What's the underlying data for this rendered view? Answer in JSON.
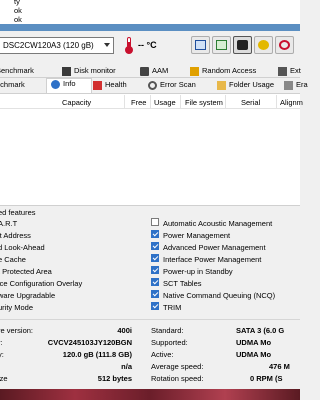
{
  "top_lines": [
    "ty",
    "ok",
    "ok"
  ],
  "toolbar": {
    "disk_select": "DSC2CW120A3 (120 gB)",
    "temperature": "-- °C",
    "colors": {
      "accent": "#2e71c7",
      "heart": "#d23030",
      "thermo": "#c8102e"
    }
  },
  "tabs_row1": [
    {
      "label": "Benchmark",
      "icon": "benchmark-icon"
    },
    {
      "label": "Disk monitor",
      "icon": "disk-monitor-icon"
    },
    {
      "label": "AAM",
      "icon": "speaker-icon"
    },
    {
      "label": "Random Access",
      "icon": "random-access-icon"
    },
    {
      "label": "Ext",
      "icon": "extra-icon"
    }
  ],
  "tabs_row2": [
    {
      "label": "nchmark",
      "icon": ""
    },
    {
      "label": "Info",
      "icon": "info-icon"
    },
    {
      "label": "Health",
      "icon": "health-icon"
    },
    {
      "label": "Error Scan",
      "icon": "error-scan-icon"
    },
    {
      "label": "Folder Usage",
      "icon": "folder-icon"
    },
    {
      "label": "Era",
      "icon": "erase-icon"
    }
  ],
  "partition_table": {
    "columns": [
      "Capacity",
      "Free",
      "Usage",
      "File system",
      "Serial",
      "Alignm"
    ]
  },
  "features": {
    "title": "ed features",
    "left": [
      "A.R.T",
      "it Address",
      "d Look-Ahead",
      "e Cache",
      "t Protected Area",
      "ice Configuration Overlay",
      "ware Upgradable",
      "urity Mode"
    ],
    "right": [
      {
        "label": "Automatic Acoustic Management",
        "checked": false
      },
      {
        "label": "Power Management",
        "checked": true
      },
      {
        "label": "Advanced Power Management",
        "checked": true
      },
      {
        "label": "Interface Power Management",
        "checked": true
      },
      {
        "label": "Power-up in Standby",
        "checked": true
      },
      {
        "label": "SCT Tables",
        "checked": true
      },
      {
        "label": "Native Command Queuing (NCQ)",
        "checked": true
      },
      {
        "label": "TRIM",
        "checked": true
      }
    ]
  },
  "info_left": [
    {
      "label": "re version:",
      "value": "400i"
    },
    {
      "label": "r:",
      "value": "CVCV245103JY120BGN"
    },
    {
      "label": "y:",
      "value": "120.0 gB (111.8 GB)"
    },
    {
      "label": "",
      "value": "n/a"
    },
    {
      "label": "ize",
      "value": "512 bytes"
    }
  ],
  "info_right": [
    {
      "label": "Standard:",
      "value": "SATA 3 (6.0 G"
    },
    {
      "label": "Supported:",
      "value": "UDMA Mo"
    },
    {
      "label": "Active:",
      "value": "UDMA Mo"
    },
    {
      "label": "Average speed:",
      "value": "476 M"
    },
    {
      "label": "Rotation speed:",
      "value": "0 RPM (S"
    }
  ]
}
